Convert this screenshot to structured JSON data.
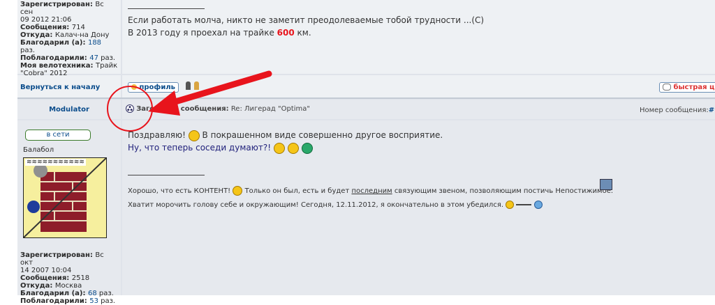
{
  "post1": {
    "profile": [
      {
        "label": "Зарегистрирован:",
        "value": "Вс сен"
      },
      {
        "label": "",
        "value": "09 2012 21:06"
      },
      {
        "label": "Сообщения:",
        "value": "714"
      },
      {
        "label": "Откуда:",
        "value": "Калач-на Дону"
      },
      {
        "label": "Благодарил (а):",
        "value": "188",
        "suffix": "раз."
      },
      {
        "label": "Поблагодарили:",
        "value": "47",
        "suffix": "раз."
      },
      {
        "label": "Моя велотехника:",
        "value": "Трайк"
      },
      {
        "label": "",
        "value": "\"Cobra\" 2012"
      }
    ],
    "signature_line1": "Если работать молча, никто не заметит преодолеваемые тобой трудности ...(C)",
    "signature_line2_prefix": "В 2013 году я проехал на трайке",
    "signature_line2_value": "600",
    "signature_line2_suffix": "км."
  },
  "back_to_top": "Вернуться к началу",
  "profile_button": "профиль",
  "quick_reply_button": "быстрая ци",
  "post2": {
    "author": "Modulator",
    "subject_label": "Заголовок сообщения:",
    "subject_value": "Re: Лигерад \"Optima\"",
    "post_number_label": "Номер сообщения:",
    "post_number_value": "#",
    "online_button": "в сети",
    "rank": "Балабол",
    "text_line1_a": "Поздравляю!",
    "text_line1_b": "В покрашенном виде совершенно другое восприятие.",
    "text_line2": "Ну, что теперь соседи думают?!",
    "sig_line1_a": "Хорошо, что есть КОНТЕНТ!",
    "sig_line1_b": "Только он был, есть и будет",
    "sig_line1_link": "последним",
    "sig_line1_c": "связующим звеном, позволяющим постичь Непостижимое.",
    "sig_line2": "Хватит морочить голову себе и окружающим! Сегодня, 12.11.2012, я окончательно в этом убедился.",
    "profile": [
      {
        "label": "Зарегистрирован:",
        "value": "Вс окт"
      },
      {
        "label": "",
        "value": "14 2007 10:04"
      },
      {
        "label": "Сообщения:",
        "value": "2518"
      },
      {
        "label": "Откуда:",
        "value": "Москва"
      },
      {
        "label": "Благодарил (а):",
        "value": "68",
        "suffix": "раз."
      },
      {
        "label": "Поблагодарили:",
        "value": "53",
        "suffix": "раз."
      }
    ]
  },
  "colors": {
    "accent_red": "#e8141c",
    "link_blue": "#0b4d8c",
    "navy_text": "#1f1f7a"
  }
}
